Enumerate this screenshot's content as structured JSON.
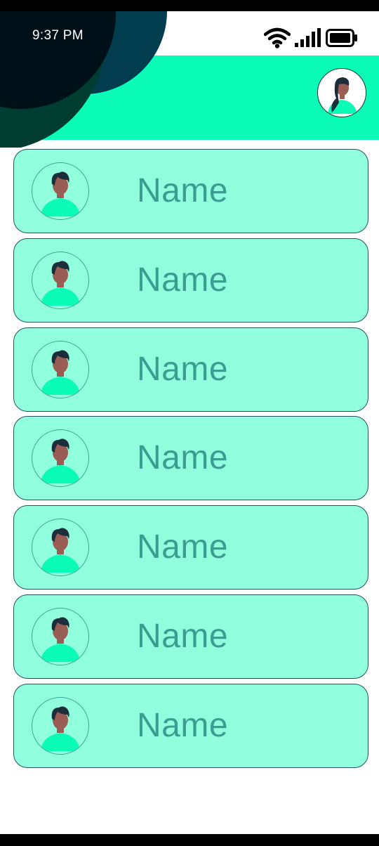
{
  "status_bar": {
    "time": "9:37 PM",
    "icons": [
      "wifi-icon",
      "signal-icon",
      "battery-icon"
    ]
  },
  "header": {
    "profile_avatar_icon": "woman-avatar-icon"
  },
  "colors": {
    "accent": "#0bfcb7",
    "card_fill": "#91ffdd",
    "card_border": "#25535a",
    "name_text": "#3a9d92",
    "blob_dark": "#001019",
    "blob_teal": "#013d4e"
  },
  "contacts": [
    {
      "name": "Name",
      "avatar_icon": "man-avatar-icon"
    },
    {
      "name": "Name",
      "avatar_icon": "man-avatar-icon"
    },
    {
      "name": "Name",
      "avatar_icon": "man-avatar-icon"
    },
    {
      "name": "Name",
      "avatar_icon": "man-avatar-icon"
    },
    {
      "name": "Name",
      "avatar_icon": "man-avatar-icon"
    },
    {
      "name": "Name",
      "avatar_icon": "man-avatar-icon"
    },
    {
      "name": "Name",
      "avatar_icon": "man-avatar-icon"
    }
  ]
}
